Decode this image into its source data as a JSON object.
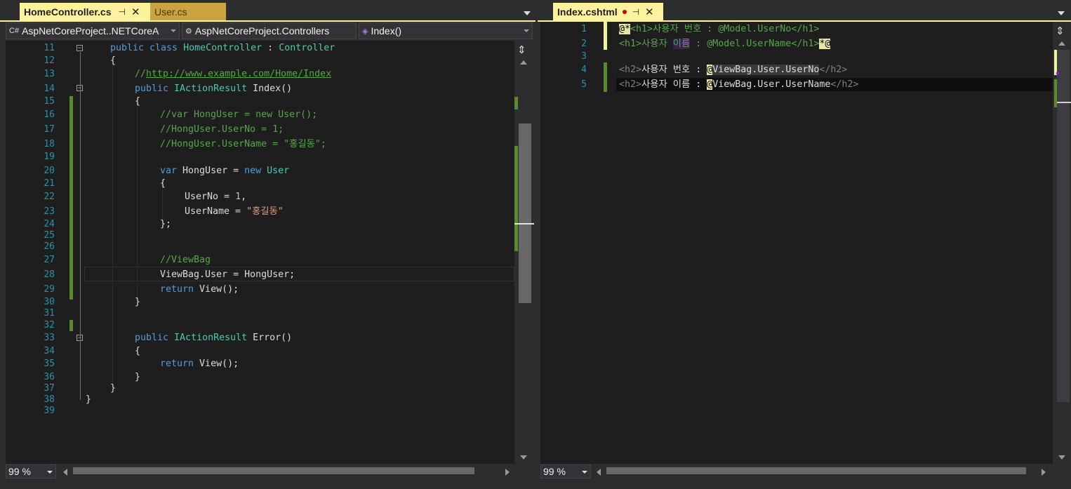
{
  "left_pane": {
    "tabs": [
      {
        "label": "HomeController.cs",
        "active": true
      },
      {
        "label": "User.cs",
        "active": false
      }
    ],
    "nav": {
      "project": "AspNetCoreProject..NETCoreA",
      "class": "AspNetCoreProject.Controllers",
      "member": "Index()"
    },
    "zoom": "99 %",
    "code_lines": [
      {
        "n": "11"
      },
      {
        "n": "12"
      },
      {
        "n": "13"
      },
      {
        "n": "14"
      },
      {
        "n": "15"
      },
      {
        "n": "16"
      },
      {
        "n": "17"
      },
      {
        "n": "18"
      },
      {
        "n": "19"
      },
      {
        "n": "20"
      },
      {
        "n": "21"
      },
      {
        "n": "22"
      },
      {
        "n": "23"
      },
      {
        "n": "24"
      },
      {
        "n": "25"
      },
      {
        "n": "26"
      },
      {
        "n": "27"
      },
      {
        "n": "28"
      },
      {
        "n": "29"
      },
      {
        "n": "30"
      },
      {
        "n": "31"
      },
      {
        "n": "32"
      },
      {
        "n": "33"
      },
      {
        "n": "34"
      },
      {
        "n": "35"
      },
      {
        "n": "36"
      },
      {
        "n": "37"
      },
      {
        "n": "38"
      },
      {
        "n": "39"
      }
    ],
    "code": {
      "l11_kw": "public class ",
      "l11_ty": "HomeController",
      "l11_pl": " : ",
      "l11_ty2": "Controller",
      "l12": "{",
      "l13_cm": "//",
      "l13_link": "http://www.example.com/Home/Index",
      "l14_kw": "public ",
      "l14_ty": "IActionResult",
      "l14_pl": " Index()",
      "l15": "{",
      "l16": "//var HongUser = new User();",
      "l17": "//HongUser.UserNo = 1;",
      "l18": "//HongUser.UserName = \"홍길동\";",
      "l20_kw": "var",
      "l20_pl": " HongUser = ",
      "l20_kw2": "new",
      "l20_ty": " User",
      "l21": "{",
      "l22_pl": "UserNo = ",
      "l22_nm": "1",
      "l22_pl2": ",",
      "l23_pl": "UserName = ",
      "l23_st": "\"홍길동\"",
      "l24": "};",
      "l27": "//ViewBag",
      "l28": "ViewBag.User = HongUser;",
      "l29_kw": "return",
      "l29_pl": " View();",
      "l30": "}",
      "l33_kw": "public ",
      "l33_ty": "IActionResult",
      "l33_pl": " Error()",
      "l34": "{",
      "l35_kw": "return",
      "l35_pl": " View();",
      "l36": "}",
      "l37": "}",
      "l38": "}"
    }
  },
  "right_pane": {
    "tabs": [
      {
        "label": "Index.cshtml",
        "active": true,
        "dirty": true
      }
    ],
    "zoom": "99 %",
    "code_lines": [
      {
        "n": "1"
      },
      {
        "n": "2"
      },
      {
        "n": "3"
      },
      {
        "n": "4"
      },
      {
        "n": "5"
      }
    ],
    "code": {
      "l1_at": "@*",
      "l1_tag": "<h1>",
      "l1_text": "사용자 번호 : @Model.UserNo",
      "l1_tagc": "</h1>",
      "l2_tag": "<h1>",
      "l2_text_a": "사용자 ",
      "l2_text_b": "이름",
      "l2_text_c": " : @Model.UserName",
      "l2_tagc": "</h1>",
      "l2_end": "*@",
      "l4_tag": "<h2>",
      "l4_text": "사용자 번호 : ",
      "l4_at": "@",
      "l4_expr": "ViewBag.User.UserNo",
      "l4_tagc": "</h2>",
      "l5_tag": "<h2>",
      "l5_text": "사용자 이름 : ",
      "l5_at": "@",
      "l5_expr": "ViewBag.User.UserName",
      "l5_tagc": "</h2>"
    }
  },
  "icons": {
    "pin": "⊣",
    "close": "✕",
    "split": "⇕"
  },
  "colors": {
    "tab_active": "#fff29d",
    "tab_inactive": "#c9a33f",
    "editor_bg": "#1e1e1e",
    "keyword": "#569cd6",
    "type": "#4ec9b0",
    "comment": "#57a64a",
    "string": "#d69d85",
    "line_number": "#2b91af"
  }
}
